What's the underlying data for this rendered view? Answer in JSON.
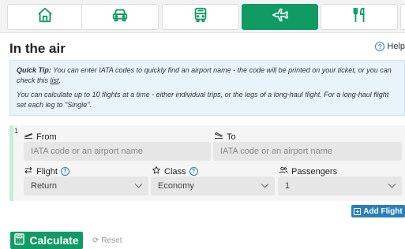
{
  "tabs": [
    {
      "icon": "home-icon",
      "active": false
    },
    {
      "icon": "car-icon",
      "active": false
    },
    {
      "icon": "bus-icon",
      "active": false
    },
    {
      "icon": "plane-icon",
      "active": true
    },
    {
      "icon": "food-icon",
      "active": false
    }
  ],
  "page": {
    "title": "In the air",
    "help_label": "Help"
  },
  "tip": {
    "quick_tip_label": "Quick Tip:",
    "line1_before_link": " You can enter IATA codes to quickly find an airport name - the code will be printed on your ticket, or you can check this ",
    "link_label": "list",
    "line1_after_link": ".",
    "line2": "You can calculate up to 10 flights at a time - either individual trips, or the legs of a long-haul flight. For a long-haul flight set each leg to \"Single\"."
  },
  "flight": {
    "row_number": "1",
    "from_label": "From",
    "from_placeholder": "IATA code or an airport name",
    "to_label": "To",
    "to_placeholder": "IATA code or an airport name",
    "flight_label": "Flight",
    "flight_value": "Return",
    "class_label": "Class",
    "class_value": "Economy",
    "passengers_label": "Passengers",
    "passengers_value": "1"
  },
  "actions": {
    "add_flight": "Add Flight",
    "calculate": "Calculate",
    "reset": "Reset"
  },
  "colors": {
    "accent_green": "#0f9b63",
    "accent_blue": "#2a7fb8",
    "tip_bg": "#e8f3fa"
  }
}
